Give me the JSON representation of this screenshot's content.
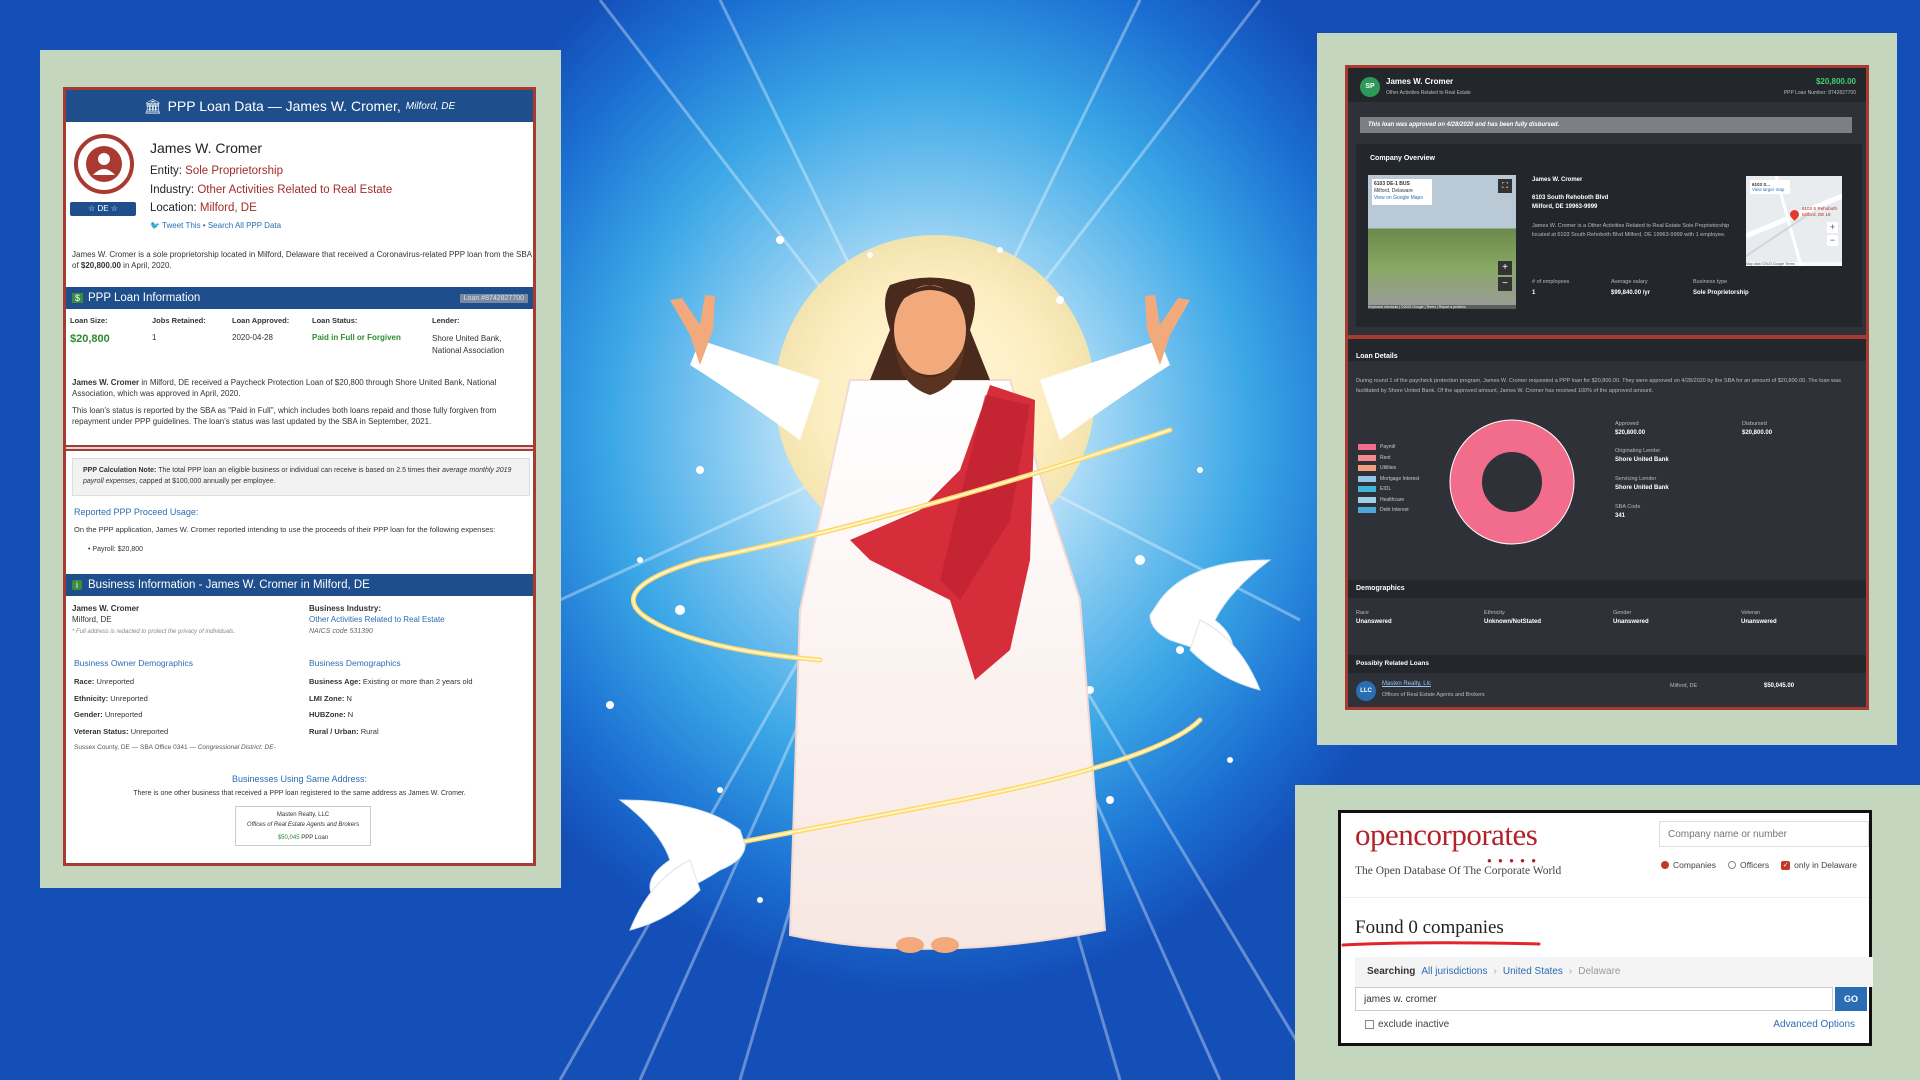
{
  "ppp": {
    "header": "PPP Loan Data — James W. Cromer,",
    "header_loc": "Milford, DE",
    "name": "James W. Cromer",
    "entity_label": "Entity:",
    "entity": "Sole Proprietorship",
    "industry_label": "Industry:",
    "industry": "Other Activities Related to Real Estate",
    "location_label": "Location:",
    "location": "Milford, DE",
    "badge": "☆ DE ☆",
    "tweet": "Tweet This",
    "search_all": "Search All PPP Data",
    "summary_a": "James W. Cromer is a sole proprietorship located in Milford, Delaware that received a Coronavirus-related PPP loan from the SBA of ",
    "summary_amt": "$20,800.00",
    "summary_b": " in April, 2020.",
    "loan_info_title": "PPP Loan Information",
    "loan_number": "Loan #8742827700",
    "cols": [
      "Loan Size:",
      "Jobs Retained:",
      "Loan Approved:",
      "Loan Status:",
      "Lender:"
    ],
    "loan_size": "$20,800",
    "jobs": "1",
    "approved": "2020-04-28",
    "status": "Paid in Full or Forgiven",
    "lender": "Shore United Bank, National Association",
    "para1_name": "James W. Cromer",
    "para1": " in Milford, DE received a Paycheck Protection Loan of $20,800 through Shore United Bank, National Association, which was approved in April, 2020.",
    "para2": "This loan's status is reported by the SBA as \"Paid in Full\", which includes both loans repaid and those fully forgiven from repayment under PPP guidelines. The loan's status was last updated by the SBA in September, 2021.",
    "calc_bold": "PPP Calculation Note:",
    "calc_a": " The total PPP loan an eligible business or individual can receive is based on 2.5 times their ",
    "calc_it": "average monthly 2019 payroll expenses",
    "calc_b": ", capped at $100,000 annually per employee.",
    "usage_title": "Reported PPP Proceed Usage:",
    "usage_text": "On the PPP application, James W. Cromer reported intending to use the proceeds of their PPP loan for the following expenses:",
    "usage_item": "Payroll: $20,800",
    "biz_title": "Business Information - James W. Cromer in Milford, DE",
    "biz_name": "James W. Cromer",
    "biz_city": "Milford, DE",
    "biz_redact": "* Full address is redacted to protect the privacy of individuals.",
    "biz_ind_label": "Business Industry:",
    "biz_ind": "Other Activities Related to Real Estate",
    "naics": "NAICS code 531390",
    "owner_demo_title": "Business Owner Demographics",
    "biz_demo_title": "Business Demographics",
    "race_l": "Race:",
    "race": "Unreported",
    "eth_l": "Ethnicity:",
    "eth": "Unreported",
    "gen_l": "Gender:",
    "gen": "Unreported",
    "vet_l": "Veteran Status:",
    "vet": "Unreported",
    "age_l": "Business Age:",
    "age": "Existing or more than 2 years old",
    "lmi_l": "LMI Zone:",
    "lmi": "N",
    "hub_l": "HUBZone:",
    "hub": "N",
    "rural_l": "Rural / Urban:",
    "rural": "Rural",
    "county_a": "Sussex County, DE — SBA Office 0341 — ",
    "county_it": "Congressional District: DE-",
    "same_title": "Businesses Using Same Address:",
    "same_text": "There is one other business that received a PPP loan registered to the same address as James W. Cromer.",
    "card_name": "Masten Realty, LLC",
    "card_ind": "Offices of Real Estate Agents and Brokers",
    "card_amt": "$50,045",
    "card_suffix": "PPP Loan"
  },
  "dark": {
    "avatar": "SP",
    "name": "James W. Cromer",
    "sub": "Other Activities Related to Real Estate",
    "amount": "$20,800.00",
    "loan_no": "PPP Loan Number: 8742827700",
    "banner": "This loan was approved on 4/28/2020 and has been fully disbursed.",
    "overview": "Company Overview",
    "sv_label": "6103 DE-1 BUS",
    "sv_sub1": "Milford, Delaware",
    "sv_sub2": "View on Google Maps",
    "sv_footer": "Keyboard shortcuts | ©2023 Google | Terms | Report a problem",
    "co_name": "James W. Cromer",
    "addr1": "6103 South Rehoboth Blvd",
    "addr2": "Milford, DE 19963-9999",
    "desc": "James W. Cromer is a Other Activities Related to Real Estate Sole Proprietorship located at 6103 South Rehoboth Blvd Milford, DE 19963-9999 with 1 employee.",
    "emp_l": "# of employees",
    "emp": "1",
    "sal_l": "Average salary",
    "sal": "$99,840.00 /yr",
    "type_l": "Business type",
    "type": "Sole Proprietorship",
    "map_label": "6103 S...",
    "map_link": "View larger map",
    "map_pin": "6103 S Rehoboth Milford, DE 19",
    "map_footer": "Map data ©2023 Google Terms",
    "loan_details": "Loan Details",
    "loan_para": "During round 1 of the paycheck protection program, James W. Cromer requested a PPP loan for $20,800.00. They were approved on 4/28/2020 by the SBA for an amount of $20,800.00. The loan was facilitated by Shore United Bank. Of the approved amount, James W. Cromer has received 100% of the approved amount.",
    "legend": [
      "Payroll",
      "Rent",
      "Utilities",
      "Mortgage Interest",
      "EIDL",
      "Healthcare",
      "Debt Interest"
    ],
    "approved_l": "Approved",
    "approved": "$20,800.00",
    "disbursed_l": "Disbursed",
    "disbursed": "$20,800.00",
    "orig_l": "Originating Lender",
    "orig": "Shore United Bank",
    "serv_l": "Servicing Lender",
    "serv": "Shore United Bank",
    "sba_l": "SBA Code",
    "sba": "341",
    "demo_title": "Demographics",
    "race_l": "Race",
    "race": "Unanswered",
    "eth_l": "Ethnicity",
    "eth": "Unknown/NotStated",
    "gen_l": "Gender",
    "gen": "Unanswered",
    "vet_l": "Veteran",
    "vet": "Unanswered",
    "related_title": "Possibly Related Loans",
    "rel_avatar": "LLC",
    "rel_name": "Masten Realty, Llc",
    "rel_ind": "Offices of Real Estate Agents and Brokers",
    "rel_city": "Milford, DE",
    "rel_amt": "$50,045.00"
  },
  "chart_data": {
    "type": "pie",
    "categories": [
      "Payroll",
      "Rent",
      "Utilities",
      "Mortgage Interest",
      "EIDL",
      "Healthcare",
      "Debt Interest"
    ],
    "values": [
      100,
      0,
      0,
      0,
      0,
      0,
      0
    ],
    "colors": [
      "#f26c8c",
      "#f48a8a",
      "#f0a07a",
      "#8fc6e8",
      "#3fb8d8",
      "#9fd0ea",
      "#4fa8d8"
    ],
    "legend": "left"
  },
  "oc": {
    "logo_a": "open",
    "logo_b": "corporates",
    "tagline": "The Open Database Of The Corporate World",
    "search_placeholder": "Company name or number",
    "opt_companies": "Companies",
    "opt_officers": "Officers",
    "opt_delaware": "only in Delaware",
    "found": "Found 0 companies",
    "searching": "Searching",
    "crumb1": "All jurisdictions",
    "crumb2": "United States",
    "crumb3": "Delaware",
    "query": "james w. cromer",
    "go": "GO",
    "exclude": "exclude inactive",
    "advanced": "Advanced Options"
  }
}
